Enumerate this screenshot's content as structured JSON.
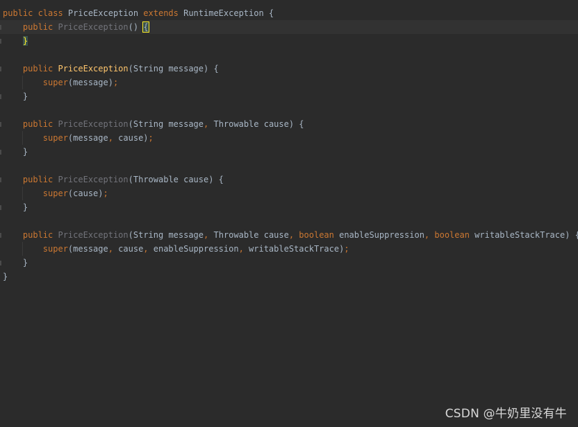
{
  "colors": {
    "background": "#2b2b2b",
    "current_line": "#323232",
    "keyword": "#cc7832",
    "method_declaration": "#ffc66d",
    "unused_symbol": "#72737a",
    "identifier": "#a9b7c6",
    "brace_highlight": "#ffef28"
  },
  "code": {
    "lines": [
      [
        {
          "t": "public class ",
          "c": "kw"
        },
        {
          "t": "PriceException ",
          "c": "plain"
        },
        {
          "t": "extends ",
          "c": "kw"
        },
        {
          "t": "RuntimeException {",
          "c": "plain"
        }
      ],
      [
        {
          "t": "    public ",
          "c": "kw"
        },
        {
          "t": "PriceException",
          "c": "ctor-unused"
        },
        {
          "t": "() ",
          "c": "plain"
        },
        {
          "t": "{",
          "c": "brace-match"
        }
      ],
      [
        {
          "t": "    ",
          "c": "plain"
        },
        {
          "t": "}",
          "c": "brace-match-close"
        }
      ],
      [],
      [
        {
          "t": "    public ",
          "c": "kw"
        },
        {
          "t": "PriceException",
          "c": "ctor"
        },
        {
          "t": "(String message) {",
          "c": "plain"
        }
      ],
      [
        {
          "t": "        super",
          "c": "kw"
        },
        {
          "t": "(message)",
          "c": "plain"
        },
        {
          "t": ";",
          "c": "punct"
        }
      ],
      [
        {
          "t": "    }",
          "c": "plain"
        }
      ],
      [],
      [
        {
          "t": "    public ",
          "c": "kw"
        },
        {
          "t": "PriceException",
          "c": "ctor-unused"
        },
        {
          "t": "(String message",
          "c": "plain"
        },
        {
          "t": ", ",
          "c": "punct"
        },
        {
          "t": "Throwable cause) {",
          "c": "plain"
        }
      ],
      [
        {
          "t": "        super",
          "c": "kw"
        },
        {
          "t": "(message",
          "c": "plain"
        },
        {
          "t": ", ",
          "c": "punct"
        },
        {
          "t": "cause)",
          "c": "plain"
        },
        {
          "t": ";",
          "c": "punct"
        }
      ],
      [
        {
          "t": "    }",
          "c": "plain"
        }
      ],
      [],
      [
        {
          "t": "    public ",
          "c": "kw"
        },
        {
          "t": "PriceException",
          "c": "ctor-unused"
        },
        {
          "t": "(Throwable cause) {",
          "c": "plain"
        }
      ],
      [
        {
          "t": "        super",
          "c": "kw"
        },
        {
          "t": "(cause)",
          "c": "plain"
        },
        {
          "t": ";",
          "c": "punct"
        }
      ],
      [
        {
          "t": "    }",
          "c": "plain"
        }
      ],
      [],
      [
        {
          "t": "    public ",
          "c": "kw"
        },
        {
          "t": "PriceException",
          "c": "ctor-unused"
        },
        {
          "t": "(String message",
          "c": "plain"
        },
        {
          "t": ", ",
          "c": "punct"
        },
        {
          "t": "Throwable cause",
          "c": "plain"
        },
        {
          "t": ", ",
          "c": "punct"
        },
        {
          "t": "boolean ",
          "c": "kw"
        },
        {
          "t": "enableSuppression",
          "c": "plain"
        },
        {
          "t": ", ",
          "c": "punct"
        },
        {
          "t": "boolean ",
          "c": "kw"
        },
        {
          "t": "writableStackTrace) {",
          "c": "plain"
        }
      ],
      [
        {
          "t": "        super",
          "c": "kw"
        },
        {
          "t": "(message",
          "c": "plain"
        },
        {
          "t": ", ",
          "c": "punct"
        },
        {
          "t": "cause",
          "c": "plain"
        },
        {
          "t": ", ",
          "c": "punct"
        },
        {
          "t": "enableSuppression",
          "c": "plain"
        },
        {
          "t": ", ",
          "c": "punct"
        },
        {
          "t": "writableStackTrace)",
          "c": "plain"
        },
        {
          "t": ";",
          "c": "punct"
        }
      ],
      [
        {
          "t": "    }",
          "c": "plain"
        }
      ],
      [
        {
          "t": "}",
          "c": "plain"
        }
      ]
    ]
  },
  "watermark": {
    "text": "CSDN @牛奶里没有牛"
  }
}
